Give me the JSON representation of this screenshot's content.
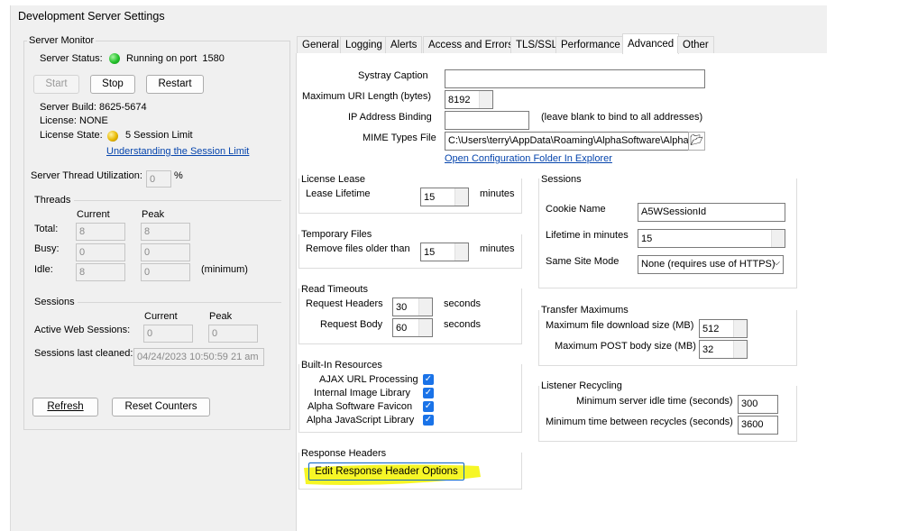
{
  "window": {
    "title": "Development Server Settings"
  },
  "server_monitor": {
    "heading": "Server Monitor",
    "status_label": "Server Status:",
    "status_value": "Running on port  1580",
    "buttons": {
      "start": "Start",
      "stop": "Stop",
      "restart": "Restart"
    },
    "build_label": "Server Build:",
    "build_value": "8625-5674",
    "license_label": "License:",
    "license_value": "NONE",
    "license_state_label": "License State:",
    "license_state_value": "5 Session Limit",
    "session_limit_link": "Understanding the Session Limit",
    "thread_util_label": "Server Thread Utilization:",
    "thread_util_value": "0",
    "thread_util_unit": "%",
    "threads": {
      "heading": "Threads",
      "col_current": "Current",
      "col_peak": "Peak",
      "rows": [
        {
          "label": "Total:",
          "current": "8",
          "peak": "8",
          "note": ""
        },
        {
          "label": "Busy:",
          "current": "0",
          "peak": "0",
          "note": ""
        },
        {
          "label": "Idle:",
          "current": "8",
          "peak": "0",
          "note": "(minimum)"
        }
      ]
    },
    "sessions": {
      "heading": "Sessions",
      "col_current": "Current",
      "col_peak": "Peak",
      "active_label": "Active Web Sessions:",
      "active_current": "0",
      "active_peak": "0",
      "cleaned_label": "Sessions last cleaned:",
      "cleaned_value": "04/24/2023 10:50:59 21 am"
    },
    "refresh": "Refresh",
    "reset": "Reset Counters"
  },
  "tabs": [
    "General",
    "Logging",
    "Alerts",
    "Access and Errors",
    "TLS/SSL",
    "Performance",
    "Advanced",
    "Other"
  ],
  "active_tab": "Advanced",
  "advanced": {
    "systray_label": "Systray Caption",
    "systray_value": "",
    "max_uri_label": "Maximum URI Length (bytes)",
    "max_uri_value": "8192",
    "ip_label": "IP Address Binding",
    "ip_value": "",
    "ip_hint": "(leave blank to bind to all addresses)",
    "mime_label": "MIME Types File",
    "mime_value": "C:\\Users\\terry\\AppData\\Roaming\\AlphaSoftware\\Alpha",
    "open_folder_link": "Open Configuration Folder In Explorer",
    "license_lease": {
      "heading": "License Lease",
      "label": "Lease Lifetime",
      "value": "15",
      "unit": "minutes"
    },
    "temp_files": {
      "heading": "Temporary Files",
      "label": "Remove files older than",
      "value": "15",
      "unit": "minutes"
    },
    "read_timeouts": {
      "heading": "Read Timeouts",
      "headers_label": "Request Headers",
      "headers_value": "30",
      "headers_unit": "seconds",
      "body_label": "Request Body",
      "body_value": "60",
      "body_unit": "seconds"
    },
    "builtin": {
      "heading": "Built-In Resources",
      "items": [
        "AJAX URL Processing",
        "Internal Image Library",
        "Alpha Software Favicon",
        "Alpha JavaScript Library"
      ]
    },
    "response_headers": {
      "heading": "Response Headers",
      "button": "Edit Response Header Options"
    },
    "sessions": {
      "heading": "Sessions",
      "cookie_label": "Cookie Name",
      "cookie_value": "A5WSessionId",
      "lifetime_label": "Lifetime in minutes",
      "lifetime_value": "15",
      "samesite_label": "Same Site Mode",
      "samesite_value": "None (requires use of HTTPS)"
    },
    "transfer": {
      "heading": "Transfer Maximums",
      "download_label": "Maximum file download size (MB)",
      "download_value": "512",
      "post_label": "Maximum POST body size (MB)",
      "post_value": "32"
    },
    "recycling": {
      "heading": "Listener Recycling",
      "idle_label": "Minimum server idle time (seconds)",
      "idle_value": "300",
      "between_label": "Minimum time between recycles (seconds)",
      "between_value": "3600"
    }
  },
  "colors": {
    "highlight": "#f4f400",
    "led_green": "#22c02a",
    "led_yellow": "#e8b800",
    "check_blue": "#1a73e8"
  }
}
